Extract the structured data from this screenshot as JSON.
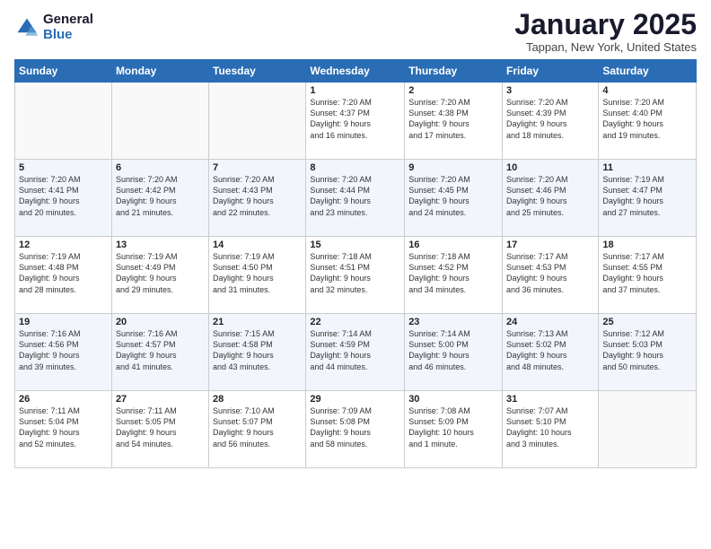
{
  "logo": {
    "general": "General",
    "blue": "Blue"
  },
  "header": {
    "month": "January 2025",
    "location": "Tappan, New York, United States"
  },
  "weekdays": [
    "Sunday",
    "Monday",
    "Tuesday",
    "Wednesday",
    "Thursday",
    "Friday",
    "Saturday"
  ],
  "weeks": [
    [
      {
        "day": "",
        "info": ""
      },
      {
        "day": "",
        "info": ""
      },
      {
        "day": "",
        "info": ""
      },
      {
        "day": "1",
        "info": "Sunrise: 7:20 AM\nSunset: 4:37 PM\nDaylight: 9 hours\nand 16 minutes."
      },
      {
        "day": "2",
        "info": "Sunrise: 7:20 AM\nSunset: 4:38 PM\nDaylight: 9 hours\nand 17 minutes."
      },
      {
        "day": "3",
        "info": "Sunrise: 7:20 AM\nSunset: 4:39 PM\nDaylight: 9 hours\nand 18 minutes."
      },
      {
        "day": "4",
        "info": "Sunrise: 7:20 AM\nSunset: 4:40 PM\nDaylight: 9 hours\nand 19 minutes."
      }
    ],
    [
      {
        "day": "5",
        "info": "Sunrise: 7:20 AM\nSunset: 4:41 PM\nDaylight: 9 hours\nand 20 minutes."
      },
      {
        "day": "6",
        "info": "Sunrise: 7:20 AM\nSunset: 4:42 PM\nDaylight: 9 hours\nand 21 minutes."
      },
      {
        "day": "7",
        "info": "Sunrise: 7:20 AM\nSunset: 4:43 PM\nDaylight: 9 hours\nand 22 minutes."
      },
      {
        "day": "8",
        "info": "Sunrise: 7:20 AM\nSunset: 4:44 PM\nDaylight: 9 hours\nand 23 minutes."
      },
      {
        "day": "9",
        "info": "Sunrise: 7:20 AM\nSunset: 4:45 PM\nDaylight: 9 hours\nand 24 minutes."
      },
      {
        "day": "10",
        "info": "Sunrise: 7:20 AM\nSunset: 4:46 PM\nDaylight: 9 hours\nand 25 minutes."
      },
      {
        "day": "11",
        "info": "Sunrise: 7:19 AM\nSunset: 4:47 PM\nDaylight: 9 hours\nand 27 minutes."
      }
    ],
    [
      {
        "day": "12",
        "info": "Sunrise: 7:19 AM\nSunset: 4:48 PM\nDaylight: 9 hours\nand 28 minutes."
      },
      {
        "day": "13",
        "info": "Sunrise: 7:19 AM\nSunset: 4:49 PM\nDaylight: 9 hours\nand 29 minutes."
      },
      {
        "day": "14",
        "info": "Sunrise: 7:19 AM\nSunset: 4:50 PM\nDaylight: 9 hours\nand 31 minutes."
      },
      {
        "day": "15",
        "info": "Sunrise: 7:18 AM\nSunset: 4:51 PM\nDaylight: 9 hours\nand 32 minutes."
      },
      {
        "day": "16",
        "info": "Sunrise: 7:18 AM\nSunset: 4:52 PM\nDaylight: 9 hours\nand 34 minutes."
      },
      {
        "day": "17",
        "info": "Sunrise: 7:17 AM\nSunset: 4:53 PM\nDaylight: 9 hours\nand 36 minutes."
      },
      {
        "day": "18",
        "info": "Sunrise: 7:17 AM\nSunset: 4:55 PM\nDaylight: 9 hours\nand 37 minutes."
      }
    ],
    [
      {
        "day": "19",
        "info": "Sunrise: 7:16 AM\nSunset: 4:56 PM\nDaylight: 9 hours\nand 39 minutes."
      },
      {
        "day": "20",
        "info": "Sunrise: 7:16 AM\nSunset: 4:57 PM\nDaylight: 9 hours\nand 41 minutes."
      },
      {
        "day": "21",
        "info": "Sunrise: 7:15 AM\nSunset: 4:58 PM\nDaylight: 9 hours\nand 43 minutes."
      },
      {
        "day": "22",
        "info": "Sunrise: 7:14 AM\nSunset: 4:59 PM\nDaylight: 9 hours\nand 44 minutes."
      },
      {
        "day": "23",
        "info": "Sunrise: 7:14 AM\nSunset: 5:00 PM\nDaylight: 9 hours\nand 46 minutes."
      },
      {
        "day": "24",
        "info": "Sunrise: 7:13 AM\nSunset: 5:02 PM\nDaylight: 9 hours\nand 48 minutes."
      },
      {
        "day": "25",
        "info": "Sunrise: 7:12 AM\nSunset: 5:03 PM\nDaylight: 9 hours\nand 50 minutes."
      }
    ],
    [
      {
        "day": "26",
        "info": "Sunrise: 7:11 AM\nSunset: 5:04 PM\nDaylight: 9 hours\nand 52 minutes."
      },
      {
        "day": "27",
        "info": "Sunrise: 7:11 AM\nSunset: 5:05 PM\nDaylight: 9 hours\nand 54 minutes."
      },
      {
        "day": "28",
        "info": "Sunrise: 7:10 AM\nSunset: 5:07 PM\nDaylight: 9 hours\nand 56 minutes."
      },
      {
        "day": "29",
        "info": "Sunrise: 7:09 AM\nSunset: 5:08 PM\nDaylight: 9 hours\nand 58 minutes."
      },
      {
        "day": "30",
        "info": "Sunrise: 7:08 AM\nSunset: 5:09 PM\nDaylight: 10 hours\nand 1 minute."
      },
      {
        "day": "31",
        "info": "Sunrise: 7:07 AM\nSunset: 5:10 PM\nDaylight: 10 hours\nand 3 minutes."
      },
      {
        "day": "",
        "info": ""
      }
    ]
  ]
}
